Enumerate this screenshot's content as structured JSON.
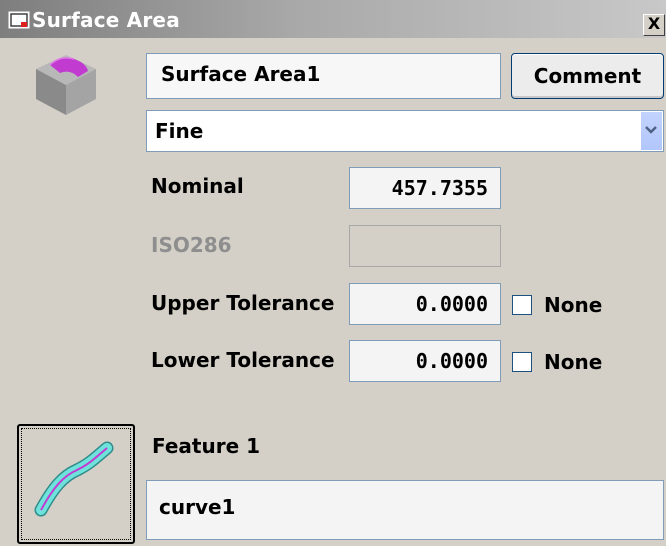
{
  "window": {
    "title": "Surface Area",
    "close_label": "X",
    "title_icon": "dialog-window-icon"
  },
  "header": {
    "feature_icon": "surface-area-cube-icon",
    "name_value": "Surface Area1",
    "comment_label": "Comment"
  },
  "resolution": {
    "selected": "Fine",
    "arrow_icon": "chevron-down-icon"
  },
  "nominal": {
    "label": "Nominal",
    "value": "457.7355"
  },
  "iso286": {
    "label": "ISO286",
    "value": ""
  },
  "upper_tolerance": {
    "label": "Upper Tolerance",
    "value": "0.0000",
    "none_label": "None",
    "none_checked": false
  },
  "lower_tolerance": {
    "label": "Lower Tolerance",
    "value": "0.0000",
    "none_label": "None",
    "none_checked": false
  },
  "feature": {
    "label": "Feature 1",
    "icon": "curve-feature-icon",
    "value": "curve1"
  },
  "colors": {
    "title_gradient_start": "#7e7e7e",
    "dialog_background": "#d4d0c8",
    "feature_magenta": "#c13bd1",
    "curve_teal": "#4fd6d0",
    "field_border": "#7f9db9"
  }
}
